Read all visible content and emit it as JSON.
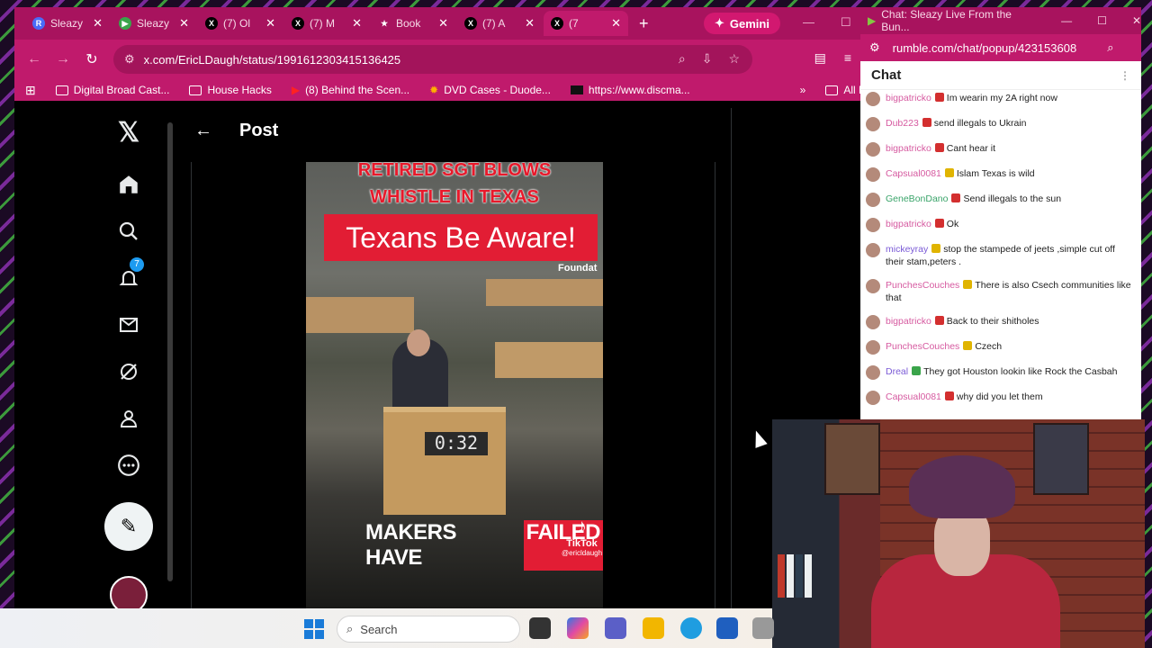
{
  "browser": {
    "tabs": [
      {
        "label": "Sleazy",
        "favicon": "R",
        "color": "#4a6cf7"
      },
      {
        "label": "Sleazy",
        "favicon": "▶",
        "color": "#3aa44a"
      },
      {
        "label": "(7) Ol",
        "favicon": "X",
        "color": "#000000"
      },
      {
        "label": "(7) M",
        "favicon": "X",
        "color": "#000000"
      },
      {
        "label": "Book",
        "favicon": "★",
        "color": "#ffffff"
      },
      {
        "label": "(7) A",
        "favicon": "X",
        "color": "#000000"
      },
      {
        "label": "(7",
        "favicon": "X",
        "color": "#000000"
      }
    ],
    "gemini_label": "Gemini",
    "url": "x.com/EricLDaugh/status/1991612303415136425",
    "bookmarks": [
      "Digital Broad Cast...",
      "House Hacks",
      "(8) Behind the Scen...",
      "DVD Cases - Duode...",
      "https://www.discma..."
    ],
    "bookmarks_overflow": "All Boo"
  },
  "x": {
    "post_title": "Post",
    "notification_count": "7"
  },
  "video": {
    "top_text": "RETIRED SGT BLOWS WHISTLE IN TEXAS",
    "banner": "Texans Be Aware!",
    "foundation_text": "Foundat",
    "timer": "0:32",
    "bottom_text_a": "MAKERS HAVE",
    "bottom_text_b": "FAILED",
    "tiktok": "TikTok",
    "tiktok_handle": "@ericldaugh"
  },
  "chat": {
    "window_title": "Chat: Sleazy Live From the Bun...",
    "url": "rumble.com/chat/popup/423153608",
    "header": "Chat",
    "messages": [
      {
        "user": "bigpatricko",
        "text": "Im wearin my 2A right now",
        "color": "#d65aa0",
        "badge": "r"
      },
      {
        "user": "Dub223",
        "text": "send illegals to Ukrain",
        "color": "#d65aa0",
        "badge": "r"
      },
      {
        "user": "bigpatricko",
        "text": "Cant hear it",
        "color": "#d65aa0",
        "badge": "r"
      },
      {
        "user": "Capsual0081",
        "text": "Islam Texas is wild",
        "color": "#d65aa0",
        "badge": "y"
      },
      {
        "user": "GeneBonDano",
        "text": "Send illegals to the sun",
        "color": "#3aa46a",
        "badge": "r"
      },
      {
        "user": "bigpatricko",
        "text": "Ok",
        "color": "#d65aa0",
        "badge": "r"
      },
      {
        "user": "mickeyray",
        "text": "stop the stampede of jeets ,simple cut off their stam,peters .",
        "color": "#7a5ad6",
        "badge": "y"
      },
      {
        "user": "PunchesCouches",
        "text": "There is also Csech communities like that",
        "color": "#d65aa0",
        "badge": "y"
      },
      {
        "user": "bigpatricko",
        "text": "Back to their shitholes",
        "color": "#d65aa0",
        "badge": "r"
      },
      {
        "user": "PunchesCouches",
        "text": "Czech",
        "color": "#d65aa0",
        "badge": "y"
      },
      {
        "user": "Dreal",
        "text": "They got Houston lookin like Rock the Casbah",
        "color": "#7a5ad6",
        "badge": "g"
      },
      {
        "user": "Capsual0081",
        "text": "why did you let them",
        "color": "#d65aa0",
        "badge": "r"
      }
    ]
  },
  "taskbar": {
    "search_placeholder": "Search"
  },
  "colors": {
    "browser_chrome": "#c01a6c",
    "tabbar": "#a8135e",
    "accent_red": "#e21d34"
  }
}
